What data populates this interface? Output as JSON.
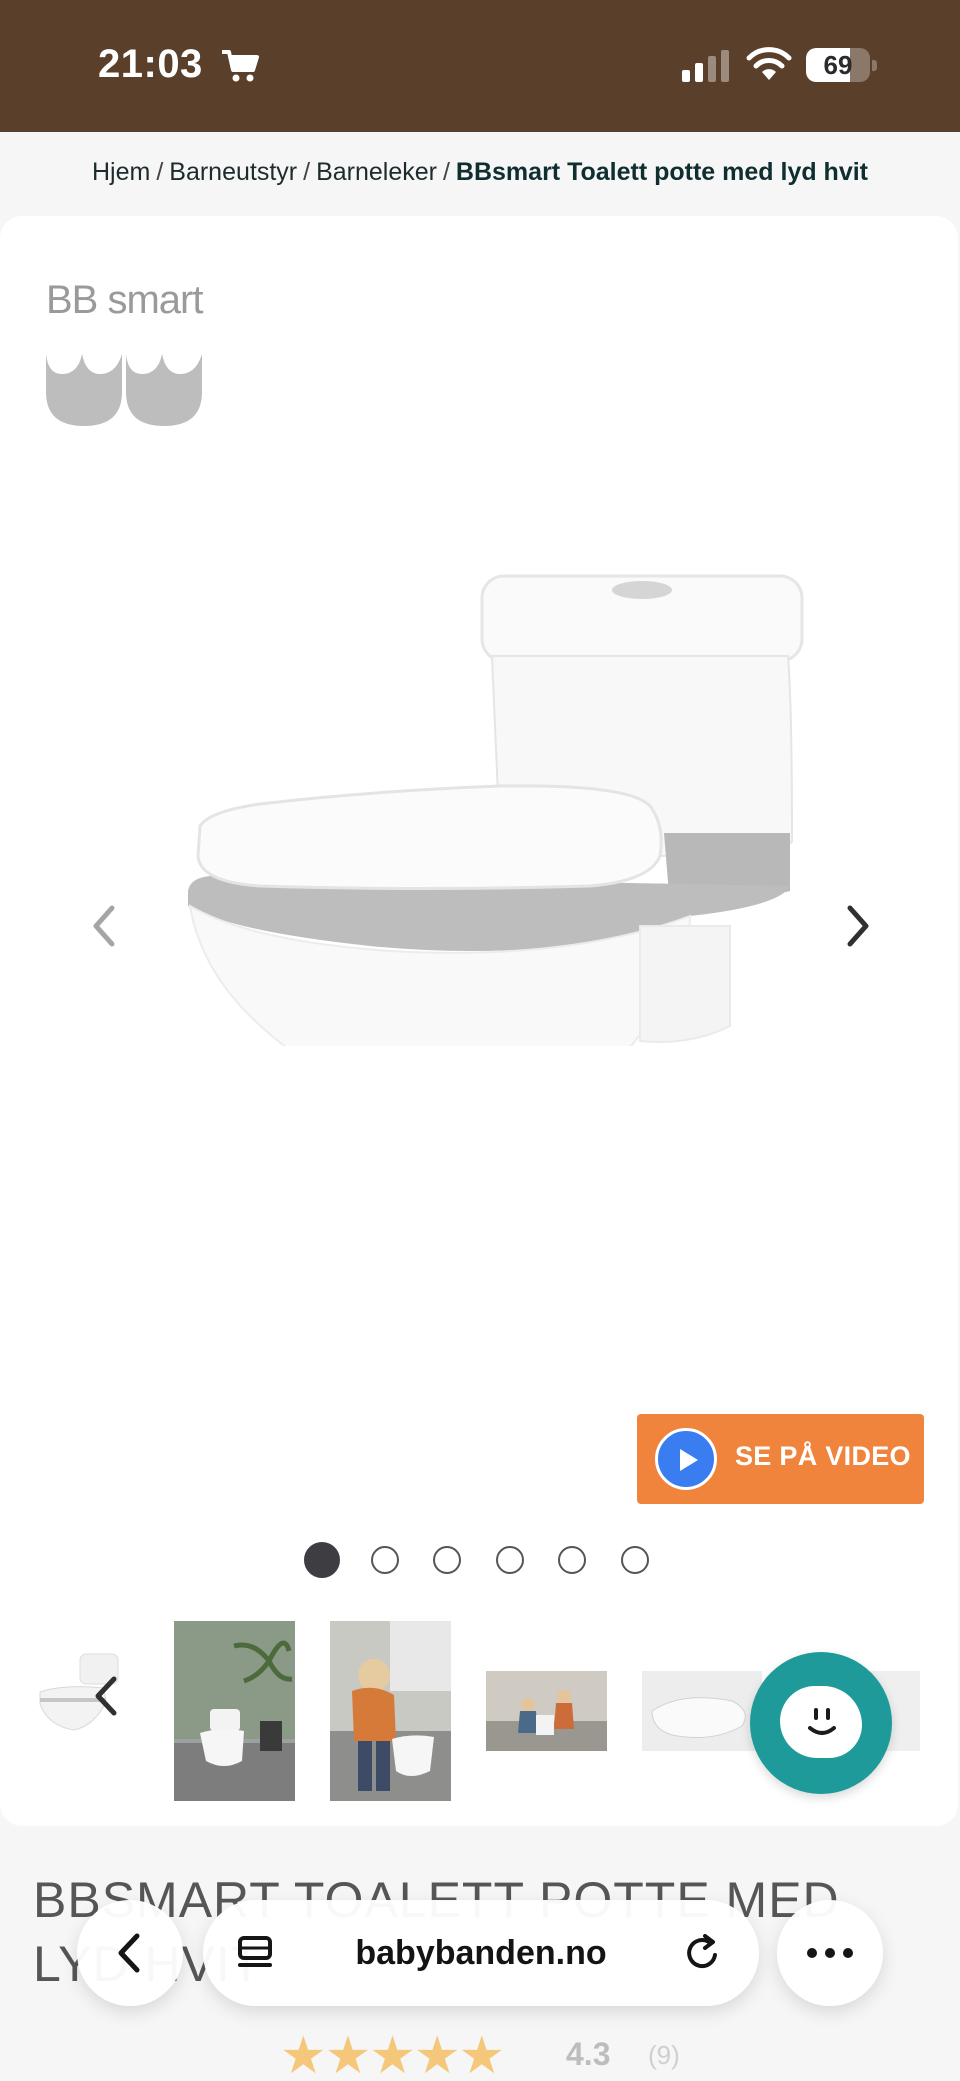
{
  "status_bar": {
    "time": "21:03",
    "battery": "69",
    "battery_level": 0.69
  },
  "breadcrumb": {
    "items": [
      "Hjem",
      "Barneutstyr",
      "Barneleker"
    ],
    "separator": "/",
    "current": "BBsmart Toalett potte med lyd hvit"
  },
  "product": {
    "brand": "BB smart",
    "video_button": "SE PÅ VIDEO",
    "gallery_dot_count": 6,
    "active_dot": 0,
    "title": "BBSMART TOALETT POTTE MED LYD HVIT",
    "rating_value": "4.3",
    "rating_count": "(9)",
    "rating_stars": "★★★★★"
  },
  "browser": {
    "url": "babybanden.no"
  },
  "colors": {
    "status_bar": "#5a3f2b",
    "video_button": "#f0843c",
    "chat_button": "#1f9a9a",
    "play_circle": "#3a7df0",
    "stars": "#f5c77a"
  }
}
